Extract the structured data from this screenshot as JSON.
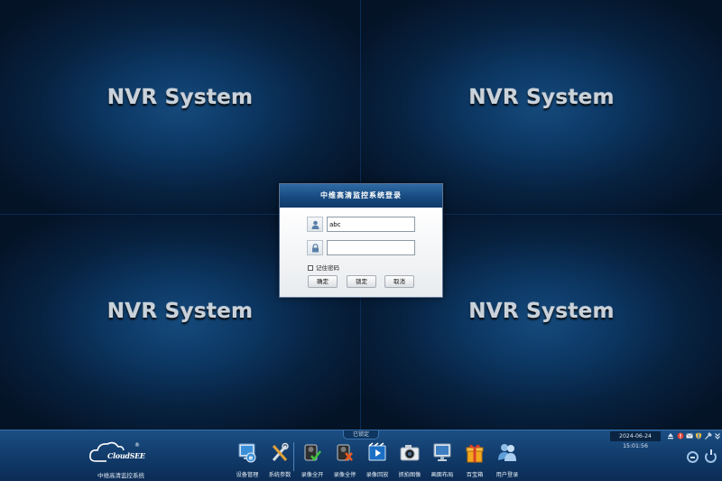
{
  "video": {
    "tiles": [
      {
        "label": "NVR System"
      },
      {
        "label": "NVR System"
      },
      {
        "label": "NVR System"
      },
      {
        "label": "NVR System"
      }
    ]
  },
  "login": {
    "title": "中维高清监控系统登录",
    "username_value": "abc",
    "password_value": "",
    "remember_label": "记住密码",
    "buttons": {
      "ok": "确定",
      "lock": "锁定",
      "cancel": "取消"
    },
    "icons": {
      "user": "user-icon",
      "password": "lock-icon"
    }
  },
  "status": {
    "lock_tab": "已锁定"
  },
  "branding": {
    "logo_text": "CloudSEE",
    "registered_mark": "®",
    "app_caption": "中维高清监控系统"
  },
  "taskbar": {
    "buttons": [
      {
        "label": "设备管理",
        "icon": "device-manager-icon"
      },
      {
        "label": "系统参数",
        "icon": "tools-icon"
      },
      {
        "label": "录像全开",
        "icon": "record-start-all-icon"
      },
      {
        "label": "录像全停",
        "icon": "record-stop-all-icon"
      },
      {
        "label": "录像回放",
        "icon": "playback-icon"
      },
      {
        "label": "抓拍图像",
        "icon": "camera-snapshot-icon"
      },
      {
        "label": "画面布局",
        "icon": "monitor-layout-icon"
      },
      {
        "label": "百宝箱",
        "icon": "gift-box-icon"
      },
      {
        "label": "用户登录",
        "icon": "users-login-icon"
      }
    ],
    "datetime": "2024-06-24 15:01:56",
    "tray_icons": [
      "eject-icon",
      "alarm-icon",
      "mail-icon",
      "shield-icon",
      "pin-icon",
      "chevron-down-icon"
    ]
  },
  "colors": {
    "video_bg": "#07213f",
    "taskbar_top": "#1c4f84",
    "dialog_title": "#174a80",
    "accent_orange": "#f5a623"
  }
}
